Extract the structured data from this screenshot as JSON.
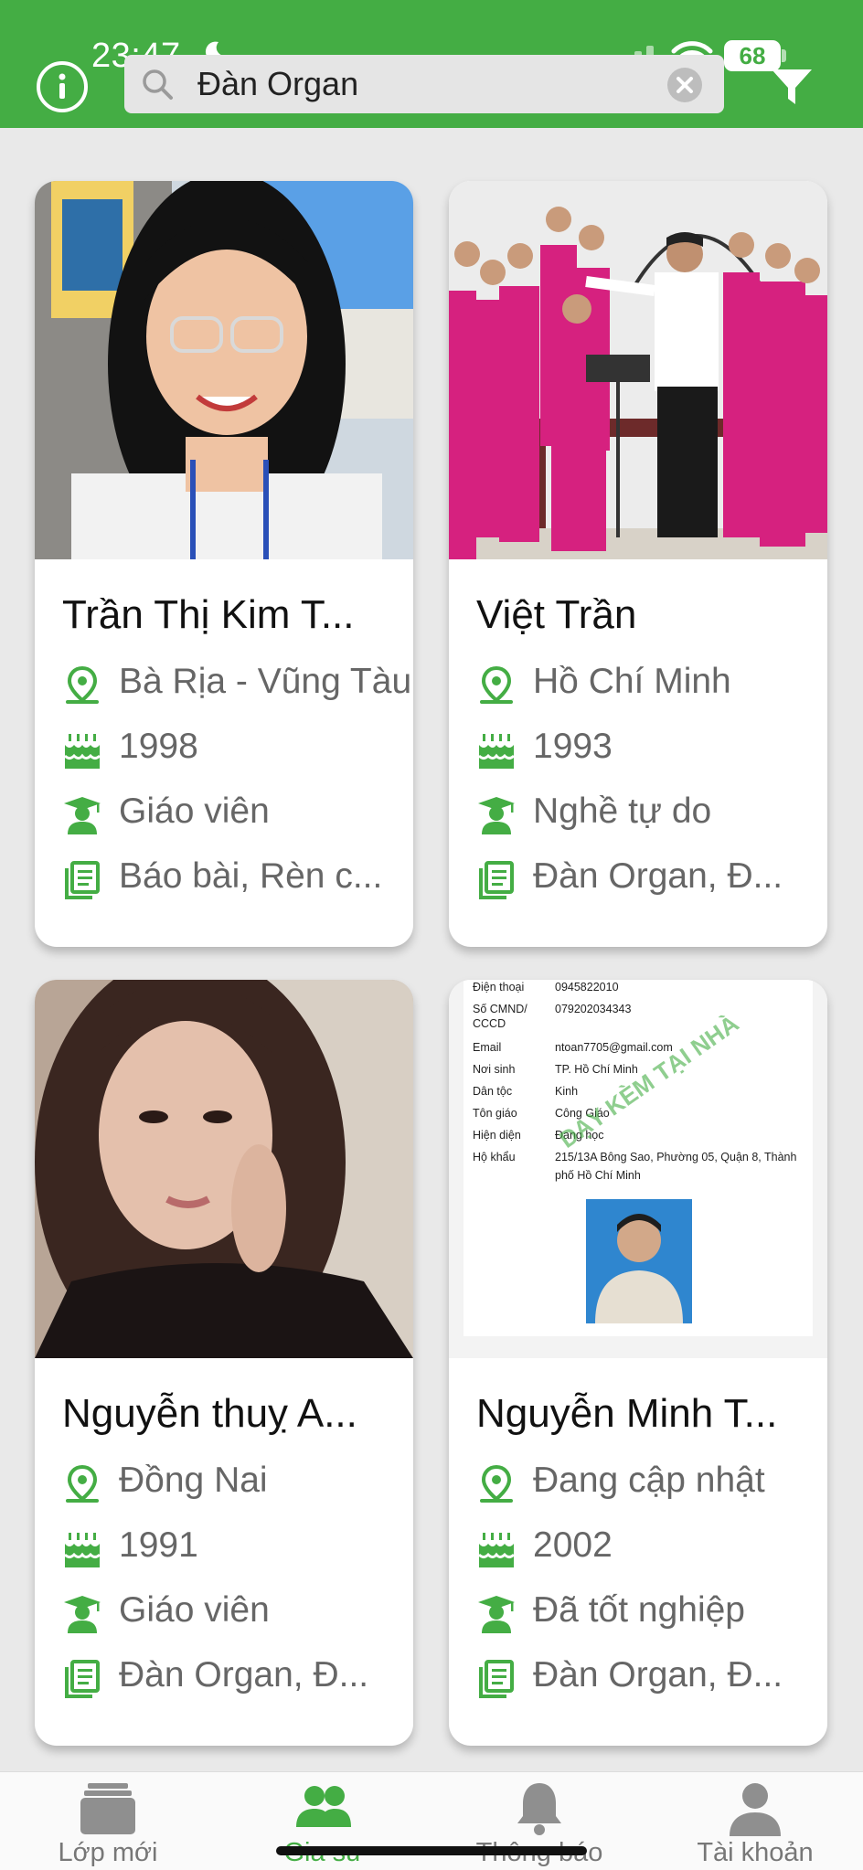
{
  "status_bar": {
    "time": "23:47",
    "battery": "68"
  },
  "search": {
    "value": "Đàn Organ"
  },
  "cards": [
    {
      "name": "Trần Thị Kim T...",
      "location": "Bà Rịa - Vũng Tàu",
      "birth_year": "1998",
      "occupation": "Giáo viên",
      "subjects": "Báo bài, Rèn c..."
    },
    {
      "name": "Việt Trần",
      "location": "Hồ Chí Minh",
      "birth_year": "1993",
      "occupation": "Nghề tự do",
      "subjects": "Đàn Organ, Đ..."
    },
    {
      "name": "Nguyễn thuỵ A...",
      "location": "Đồng Nai",
      "birth_year": "1991",
      "occupation": "Giáo viên",
      "subjects": "Đàn Organ, Đ..."
    },
    {
      "name": "Nguyễn Minh T...",
      "location": "Đang cập nhật",
      "birth_year": "2002",
      "occupation": "Đã tốt nghiệp",
      "subjects": "Đàn Organ, Đ..."
    }
  ],
  "id_document": {
    "labels": [
      "Điện thoại",
      "Số CMND/",
      "CCCD",
      "Email",
      "Nơi sinh",
      "Dân tộc",
      "Tôn giáo",
      "Hiện diện",
      "Hộ khẩu"
    ],
    "values": [
      "0945822010",
      "079202034343",
      "",
      "ntoan7705@gmail.com",
      "TP. Hồ Chí Minh",
      "Kinh",
      "Công Giáo",
      "Đang học",
      "215/13A Bông Sao, Phường 05, Quận 8, Thành",
      "phố Hồ Chí Minh"
    ],
    "watermark": "DẠY KÈM TẠI NHÀ"
  },
  "bottom_nav": [
    {
      "label": "Lớp mới",
      "icon": "classes-icon"
    },
    {
      "label": "Gia sư",
      "icon": "tutors-icon"
    },
    {
      "label": "Thông báo",
      "icon": "bell-icon"
    },
    {
      "label": "Tài khoản",
      "icon": "account-icon"
    }
  ],
  "colors": {
    "brand_green": "#44ad44",
    "background": "#e9e9e9",
    "text_muted": "#666666"
  }
}
